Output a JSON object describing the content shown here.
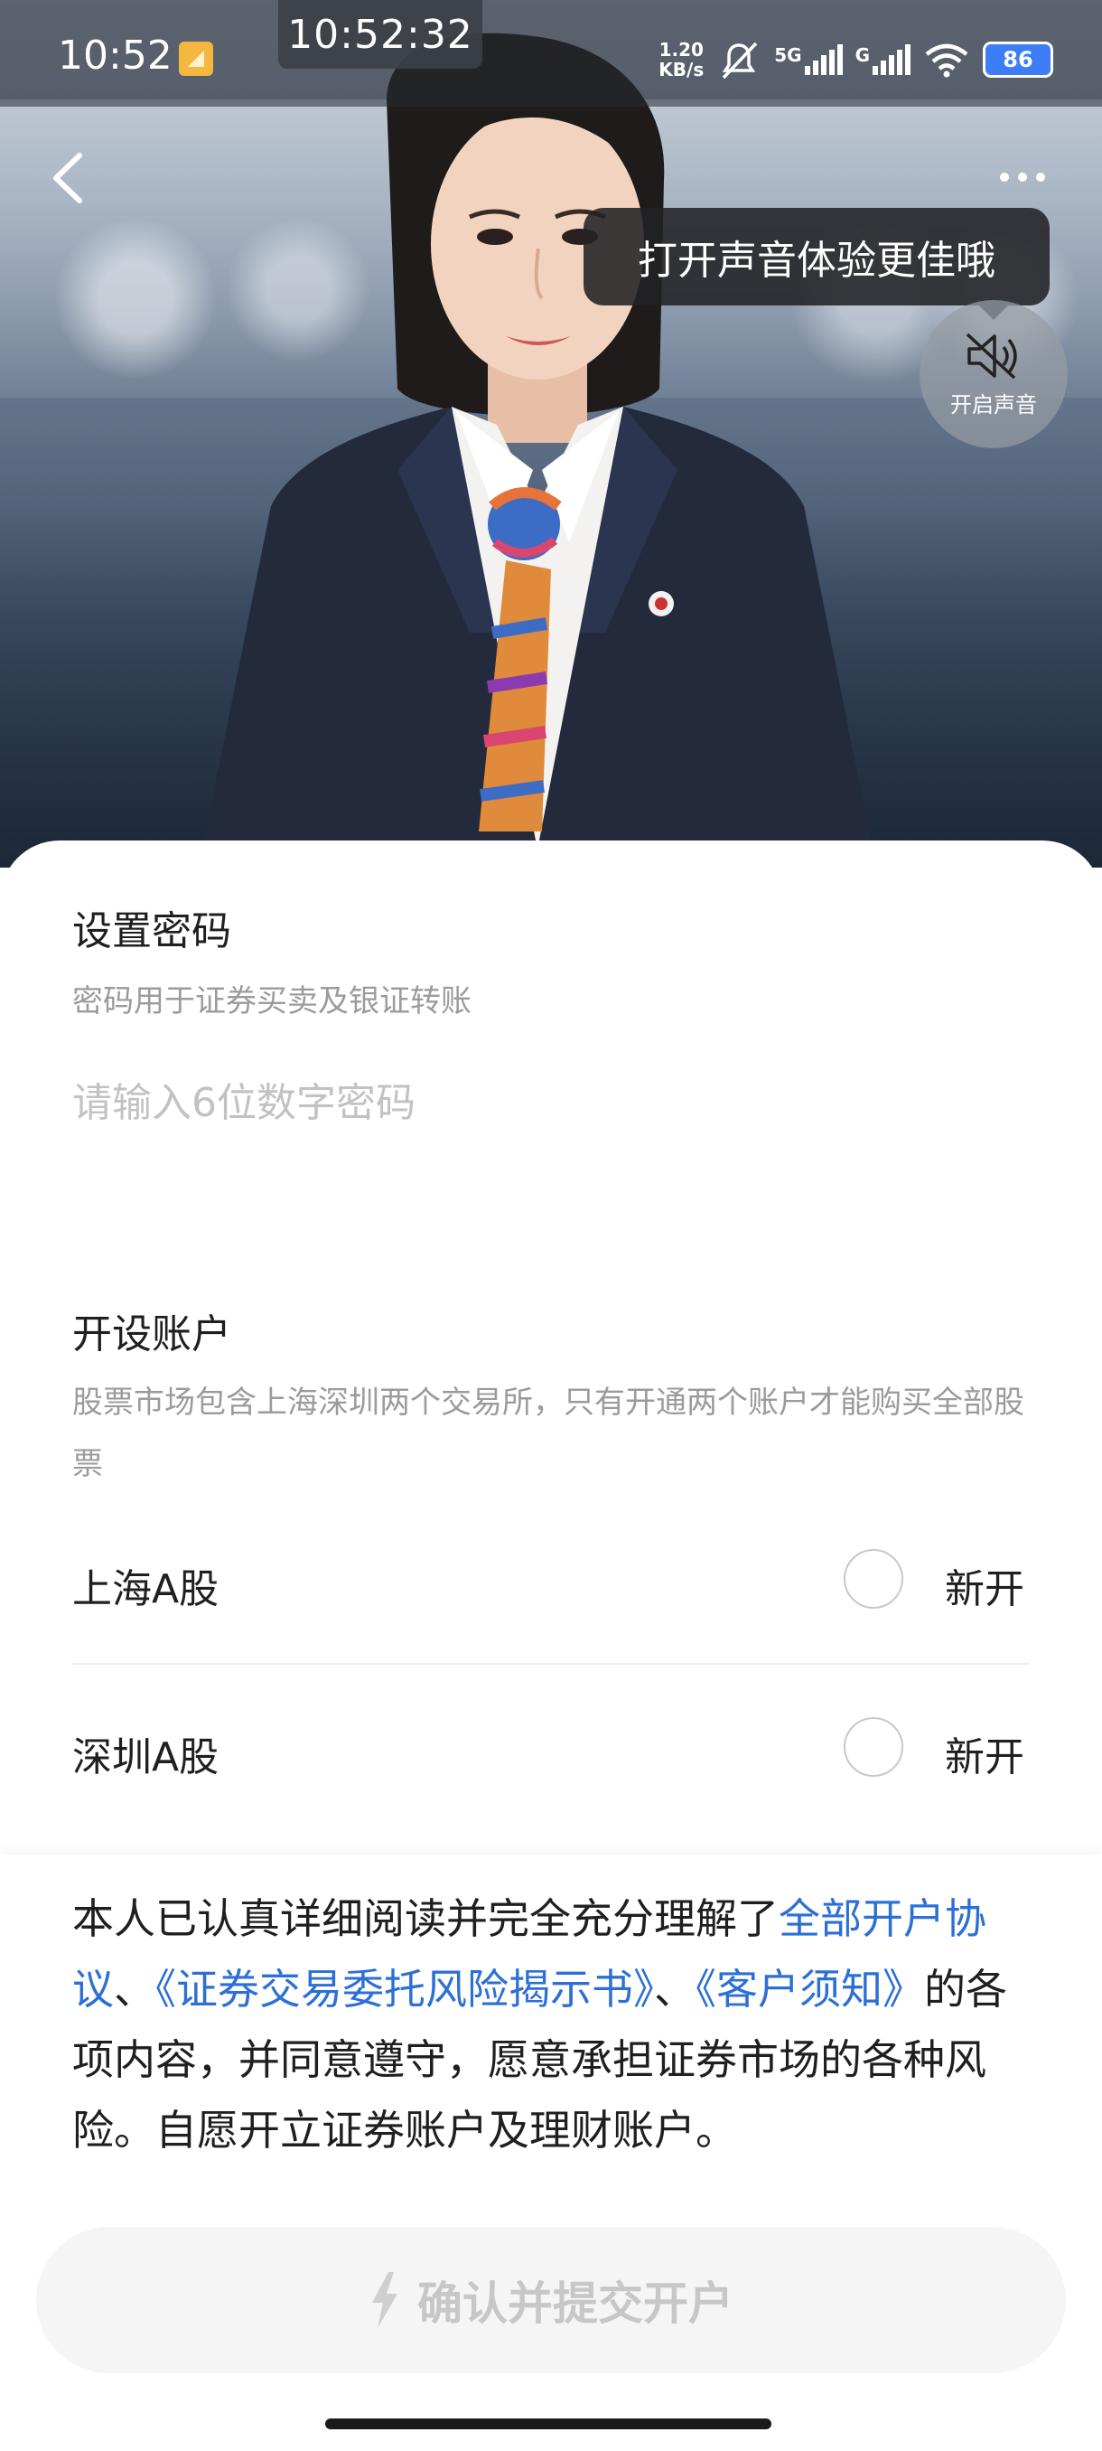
{
  "status_bar": {
    "time": "10:52",
    "recording_time": "10:52:32",
    "net_speed_value": "1.20",
    "net_speed_unit": "KB/s",
    "signal1_label": "5G",
    "signal2_label": "G",
    "battery_level": "86"
  },
  "video": {
    "sound_tooltip": "打开声音体验更佳哦",
    "sound_button_label": "开启声音"
  },
  "password_section": {
    "title": "设置密码",
    "subtitle": "密码用于证券买卖及银证转账",
    "input_value": "",
    "input_placeholder": "请输入6位数字密码"
  },
  "account_section": {
    "title": "开设账户",
    "subtitle": "股票市场包含上海深圳两个交易所，只有开通两个账户才能购买全部股票",
    "rows": [
      {
        "label": "上海A股",
        "option": "新开",
        "checked": false
      },
      {
        "label": "深圳A股",
        "option": "新开",
        "checked": false
      }
    ]
  },
  "agreement": {
    "prefix": "本人已认真详细阅读并完全充分理解了",
    "link1": "全部开户协议",
    "sep1": "、",
    "link2": "《证券交易委托风险揭示书》",
    "sep2": "、",
    "link3": "《客户须知》",
    "suffix": "的各项内容，并同意遵守，愿意承担证券市场的各种风险。自愿开立证券账户及理财账户。",
    "link_color": "#2c6fd6"
  },
  "submit": {
    "label": "确认并提交开户",
    "icon": "lightning-icon",
    "enabled": false
  }
}
